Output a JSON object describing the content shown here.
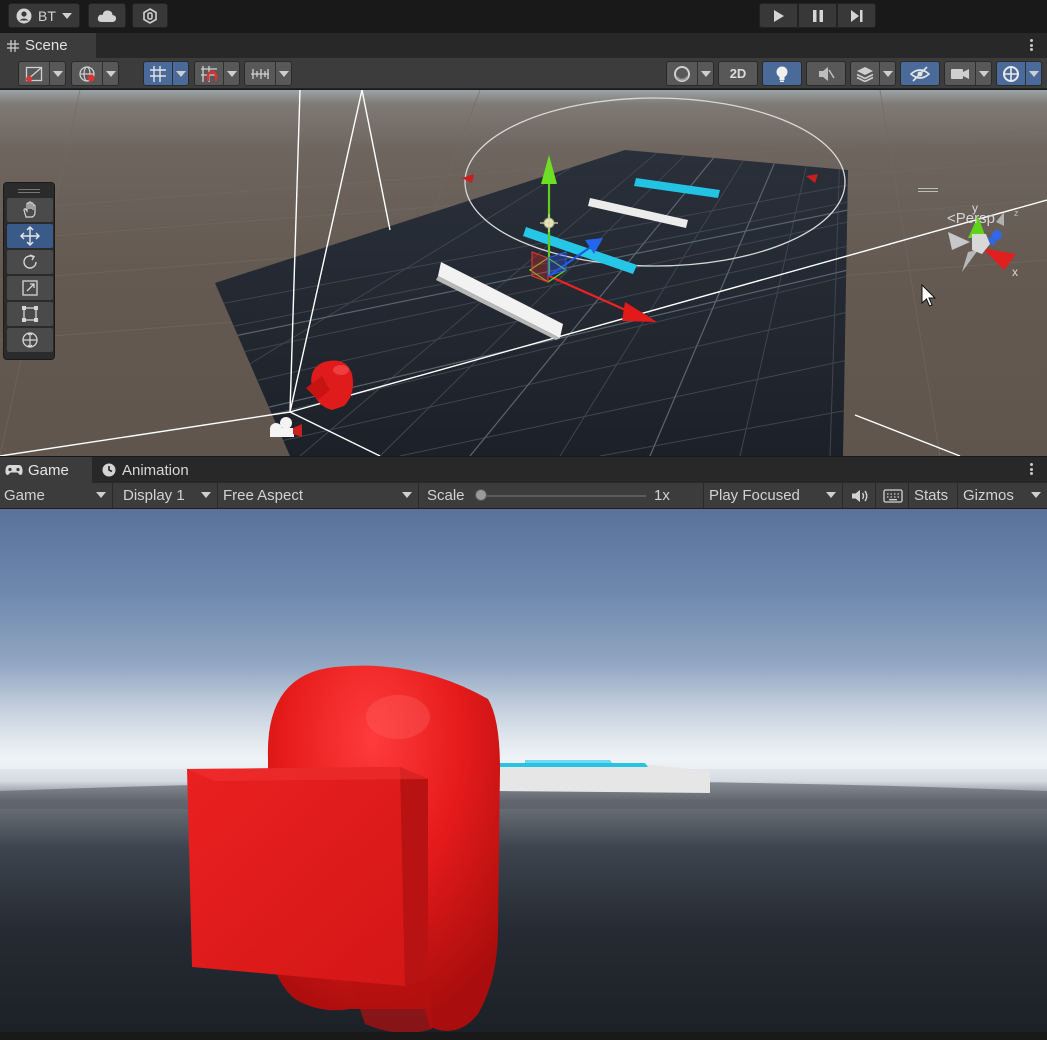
{
  "topbar": {
    "account_label": "BT",
    "icons": [
      "account-icon",
      "cloud-icon",
      "collab-icon",
      "play-icon",
      "pause-icon",
      "step-icon"
    ]
  },
  "scene": {
    "tab_label": "Scene",
    "toolbar": {
      "button_2d": "2D"
    },
    "persp_label": "Persp",
    "gizmo_axes": {
      "y": "y",
      "x": "x",
      "z": "z"
    },
    "tools": [
      "hand-tool",
      "move-tool",
      "rotate-tool",
      "scale-tool",
      "rect-tool",
      "transform-tool"
    ],
    "active_tool": "move-tool"
  },
  "game": {
    "tab_game": "Game",
    "tab_animation": "Animation",
    "toolbar": {
      "view_mode": "Game",
      "display": "Display 1",
      "aspect": "Free Aspect",
      "scale_label": "Scale",
      "scale_value": "1x",
      "play_mode": "Play Focused",
      "stats": "Stats",
      "gizmos": "Gizmos"
    }
  },
  "colors": {
    "accent_blue": "#3a5b8a",
    "cyan_bar": "#26c6e6",
    "red_character": "#e51b1b"
  }
}
